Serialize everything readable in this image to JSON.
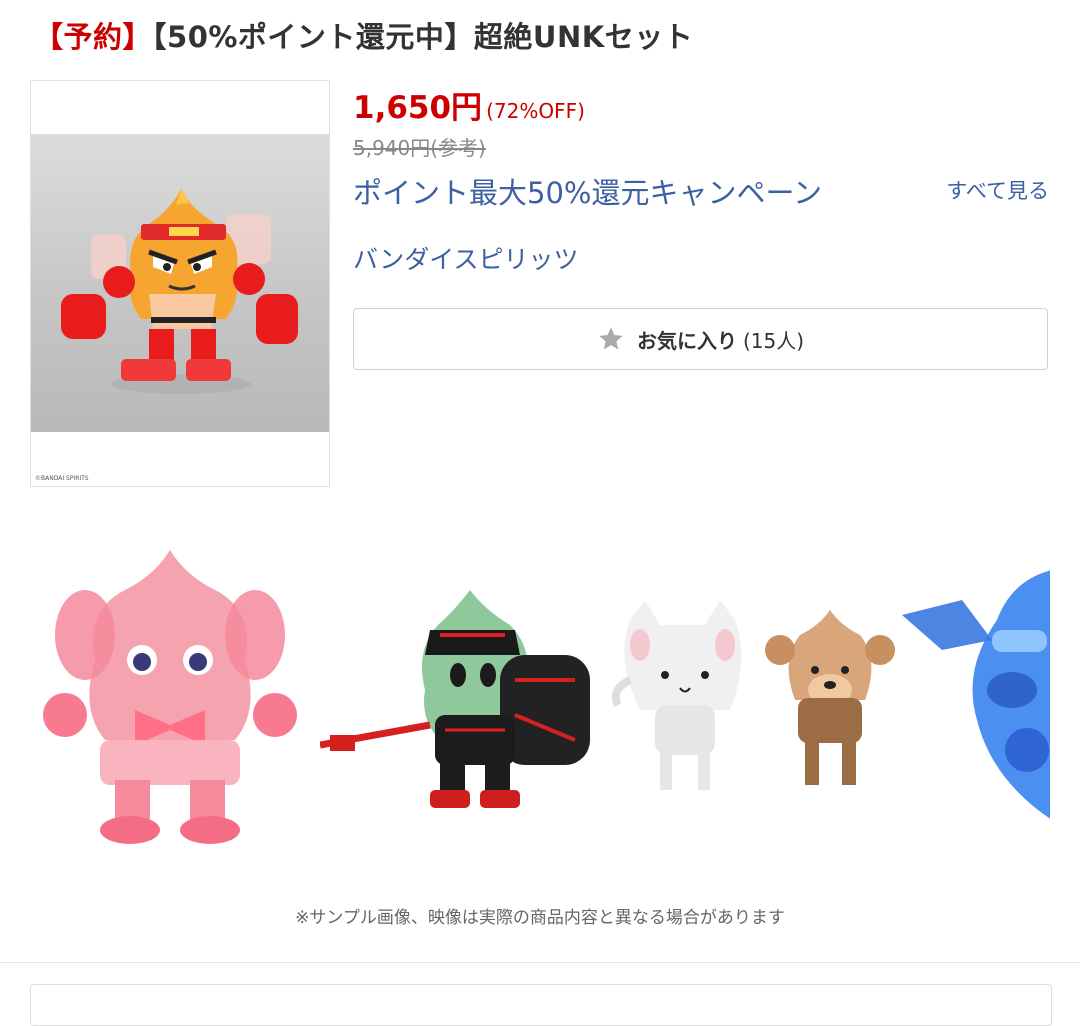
{
  "title": {
    "tag": "【予約】",
    "text": "【50%ポイント還元中】超絶UNKセット"
  },
  "main_image": {
    "credit": "©BANDAI SPIRITS"
  },
  "price": {
    "amount": "1,650円",
    "discount": "(72%OFF)",
    "reference": "5,940円(参考)"
  },
  "campaign": {
    "label": "ポイント最大50%還元キャンペーン",
    "see_all": "すべて見る"
  },
  "maker": "バンダイスピリッツ",
  "favorite": {
    "icon": "star-icon",
    "label": "お気に入り",
    "count": "(15人)"
  },
  "note": "※サンプル画像、映像は実際の商品内容と異なる場合があります",
  "colors": {
    "accent_red": "#cc0000",
    "link_blue": "#3d5fa3"
  }
}
